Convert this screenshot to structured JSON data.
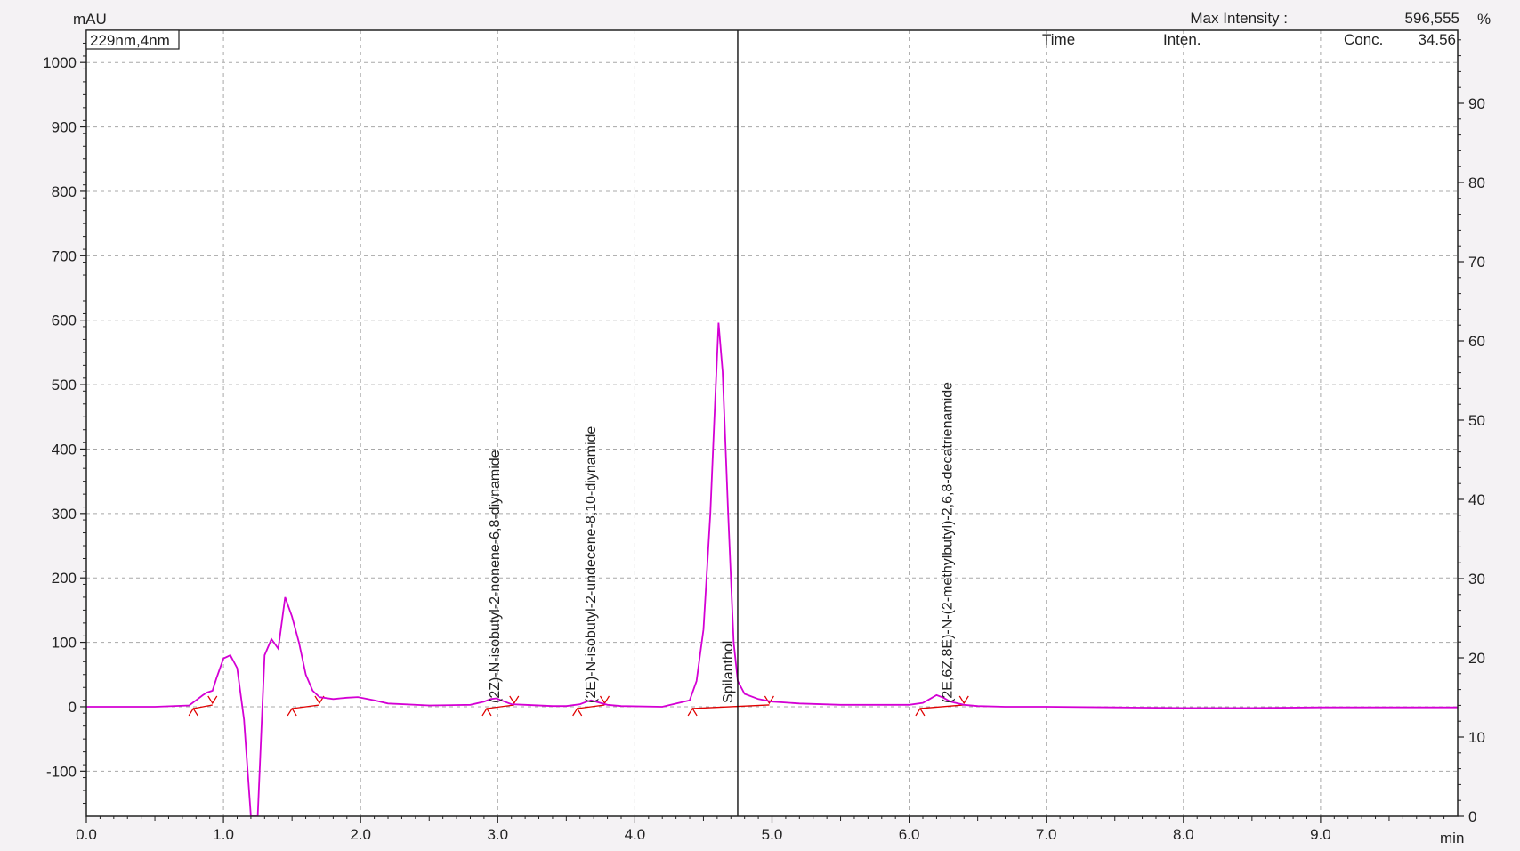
{
  "header": {
    "y_unit": "mAU",
    "x_unit": "min",
    "right_unit": "%",
    "max_intensity_label": "Max Intensity :",
    "max_intensity_value": "596,555",
    "col_time": "Time",
    "col_inten": "Inten.",
    "col_conc": "Conc.",
    "conc_value": "34.56",
    "channel_label": "229nm,4nm"
  },
  "colors": {
    "trace": "#d400d4",
    "integration": "#e00000",
    "axis": "#222222",
    "grid": "#a8a8a8",
    "channel_label": "#c000c0",
    "cursor": "#000000"
  },
  "chart_data": {
    "type": "line",
    "xlabel": "min",
    "ylabel": "mAU",
    "xlim": [
      0.0,
      10.0
    ],
    "ylim": [
      -170,
      1050
    ],
    "right_axis_lim": [
      0,
      100
    ],
    "grid": true,
    "x_ticks": [
      "0.0",
      "1.0",
      "2.0",
      "3.0",
      "4.0",
      "5.0",
      "6.0",
      "7.0",
      "8.0",
      "9.0"
    ],
    "y_ticks": [
      "-100",
      "0",
      "100",
      "200",
      "300",
      "400",
      "500",
      "600",
      "700",
      "800",
      "900",
      "1000"
    ],
    "right_ticks": [
      "0",
      "10",
      "20",
      "30",
      "40",
      "50",
      "60",
      "70",
      "80",
      "90"
    ],
    "series": [
      {
        "x": [
          0.0,
          0.5,
          0.75,
          0.8,
          0.85,
          0.88,
          0.92,
          0.95,
          1.0,
          1.05,
          1.1,
          1.15,
          1.2,
          1.25,
          1.3,
          1.35,
          1.4,
          1.45,
          1.5,
          1.55,
          1.6,
          1.65,
          1.7,
          1.8,
          1.9,
          1.98,
          2.1,
          2.2,
          2.5,
          2.8,
          2.9,
          2.95,
          2.99,
          3.05,
          3.1,
          3.2,
          3.4,
          3.5,
          3.6,
          3.65,
          3.68,
          3.73,
          3.8,
          3.9,
          4.2,
          4.4,
          4.45,
          4.5,
          4.55,
          4.58,
          4.61,
          4.64,
          4.68,
          4.72,
          4.75,
          4.8,
          4.9,
          5.0,
          5.2,
          5.5,
          6.0,
          6.1,
          6.15,
          6.2,
          6.25,
          6.3,
          6.4,
          6.5,
          6.7,
          7.0,
          7.5,
          8.0,
          8.5,
          9.0,
          9.5,
          10.0
        ],
        "y": [
          0,
          0,
          2,
          10,
          18,
          22,
          25,
          45,
          75,
          80,
          60,
          -20,
          -170,
          -170,
          80,
          105,
          90,
          170,
          140,
          100,
          50,
          25,
          15,
          12,
          14,
          15,
          10,
          5,
          2,
          3,
          8,
          12,
          13,
          8,
          4,
          3,
          1,
          1,
          4,
          8,
          10,
          7,
          3,
          1,
          0,
          10,
          40,
          120,
          300,
          450,
          596,
          520,
          300,
          100,
          40,
          20,
          12,
          8,
          5,
          3,
          3,
          6,
          12,
          18,
          14,
          8,
          3,
          1,
          0,
          0,
          -1,
          -2,
          -2,
          -1,
          -1,
          -1
        ]
      }
    ],
    "peaks": [
      {
        "label": "(2Z)-N-isobutyl-2-nonene-6,8-diynamide",
        "rt": 3.05
      },
      {
        "label": "(2E)-N-isobutyl-2-undecene-8,10-diynamide",
        "rt": 3.75
      },
      {
        "label": "Spilanthol",
        "rt": 4.75
      },
      {
        "label": "(2E,6Z,8E)-N-(2-methylbutyl)-2,6,8-decatrienamide",
        "rt": 6.35
      }
    ],
    "integration_baselines": [
      {
        "x": [
          0.78,
          0.92
        ]
      },
      {
        "x": [
          1.5,
          1.7
        ]
      },
      {
        "x": [
          2.92,
          3.12
        ]
      },
      {
        "x": [
          3.58,
          3.78
        ]
      },
      {
        "x": [
          4.42,
          4.98
        ]
      },
      {
        "x": [
          6.08,
          6.4
        ]
      }
    ],
    "cursor_x": 4.75
  }
}
